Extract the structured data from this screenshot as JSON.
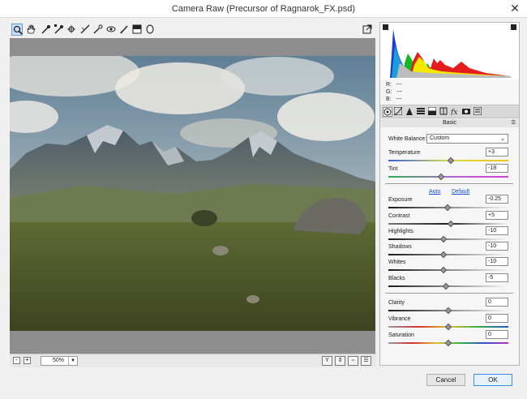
{
  "window": {
    "title": "Camera Raw (Precursor of Ragnarok_FX.psd)",
    "close_glyph": "✕"
  },
  "toolbar": {
    "tools": [
      "zoom-tool-icon",
      "hand-tool-icon",
      "white-balance-tool-icon",
      "color-sampler-tool-icon",
      "targeted-adjustment-tool-icon",
      "straighten-tool-icon",
      "spot-removal-tool-icon",
      "red-eye-removal-tool-icon",
      "adjustment-brush-icon",
      "graduated-filter-icon",
      "radial-filter-icon"
    ],
    "open_preferences": "preferences-icon"
  },
  "status": {
    "zoom_out": "-",
    "zoom_in": "+",
    "zoom_level": "50%",
    "view_buttons": [
      "Y",
      "⇕",
      "⇔",
      "☰"
    ]
  },
  "readout": {
    "r": "R:",
    "g": "G:",
    "b": "B:",
    "r_val": "---",
    "g_val": "---",
    "b_val": "---"
  },
  "panel": {
    "section": "Basic"
  },
  "white_balance": {
    "label": "White Balance:",
    "value": "Custom"
  },
  "sliders": {
    "temperature": {
      "label": "Temperature",
      "value": "+3",
      "position": 0.52
    },
    "tint": {
      "label": "Tint",
      "value": "-18",
      "position": 0.44
    },
    "exposure": {
      "label": "Exposure",
      "value": "-0.25",
      "position": 0.49
    },
    "contrast": {
      "label": "Contrast",
      "value": "+5",
      "position": 0.52
    },
    "highlights": {
      "label": "Highlights",
      "value": "-10",
      "position": 0.46
    },
    "shadows": {
      "label": "Shadows",
      "value": "-10",
      "position": 0.46
    },
    "whites": {
      "label": "Whites",
      "value": "-10",
      "position": 0.46
    },
    "blacks": {
      "label": "Blacks",
      "value": "-5",
      "position": 0.48
    },
    "clarity": {
      "label": "Clarity",
      "value": "0",
      "position": 0.5
    },
    "vibrance": {
      "label": "Vibrance",
      "value": "0",
      "position": 0.5
    },
    "saturation": {
      "label": "Saturation",
      "value": "0",
      "position": 0.5
    }
  },
  "links": {
    "auto": "Auto",
    "default": "Default"
  },
  "buttons": {
    "cancel": "Cancel",
    "ok": "OK"
  },
  "colors": {
    "accent": "#3b8ede",
    "link": "#1a4fd6",
    "canvas": "#8e8e8e"
  }
}
